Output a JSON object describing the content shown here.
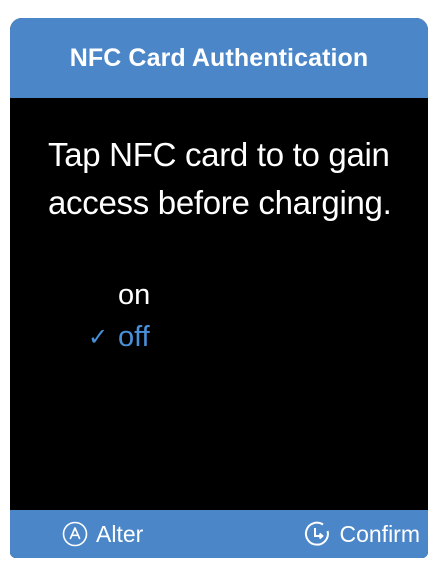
{
  "screen": {
    "title": "NFC Card Authentication",
    "message_line1": "Tap NFC card to to gain",
    "message_line2": "access before charging."
  },
  "options": [
    {
      "label": "on",
      "selected": false
    },
    {
      "label": "off",
      "selected": true,
      "check_glyph": "✓"
    }
  ],
  "softkeys": {
    "alter": {
      "label": "Alter",
      "icon": "circle-a-icon"
    },
    "confirm": {
      "label": "Confirm",
      "icon": "clock-enter-icon"
    }
  },
  "colors": {
    "header_bg": "#4a86c8",
    "screen_bg": "#000000",
    "selected_text": "#4a90d9",
    "text": "#ffffff"
  }
}
